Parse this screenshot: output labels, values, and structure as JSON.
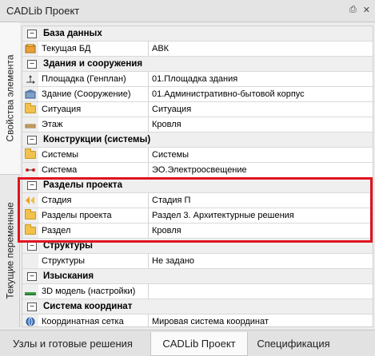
{
  "window": {
    "title": "CADLib Проект",
    "pin_icon": "pin-icon",
    "close_icon": "close-icon"
  },
  "side_tabs": [
    {
      "label": "Свойства элемента"
    },
    {
      "label": "Текущие переменные"
    }
  ],
  "grid": {
    "rows": [
      {
        "kind": "cat",
        "label": "База данных",
        "toggle": "⊟"
      },
      {
        "kind": "prop",
        "icon": "database-icon",
        "name": "Текущая БД",
        "value": "АВК"
      },
      {
        "kind": "cat",
        "label": "Здания и сооружения",
        "toggle": "⊟"
      },
      {
        "kind": "prop",
        "icon": "site-plan-icon",
        "name": "Площадка (Генплан)",
        "value": "01.Площадка здания"
      },
      {
        "kind": "prop",
        "icon": "building-icon",
        "name": "Здание (Сооружение)",
        "value": "01.Административно-бытовой корпус"
      },
      {
        "kind": "prop",
        "icon": "folder-icon",
        "name": "Ситуация",
        "value": "Ситуация"
      },
      {
        "kind": "prop",
        "icon": "floor-icon",
        "name": "Этаж",
        "value": "Кровля"
      },
      {
        "kind": "cat",
        "label": "Конструкции (системы)",
        "toggle": "⊟"
      },
      {
        "kind": "prop",
        "icon": "folder-icon",
        "name": "Системы",
        "value": "Системы"
      },
      {
        "kind": "prop",
        "icon": "system-icon",
        "name": "Система",
        "value": "ЭО.Электроосвещение"
      },
      {
        "kind": "cat",
        "label": "Разделы проекта",
        "toggle": "⊟"
      },
      {
        "kind": "prop",
        "icon": "stage-icon",
        "name": "Стадия",
        "value": "Стадия П"
      },
      {
        "kind": "prop",
        "icon": "folder-icon",
        "name": "Разделы проекта",
        "value": "Раздел 3. Архитектурные решения"
      },
      {
        "kind": "prop",
        "icon": "folder-icon",
        "name": "Раздел",
        "value": "Кровля"
      },
      {
        "kind": "cat",
        "label": "Структуры",
        "toggle": "⊟"
      },
      {
        "kind": "prop",
        "icon": "",
        "name": "Структуры",
        "value": "Не задано"
      },
      {
        "kind": "cat",
        "label": "Изыскания",
        "toggle": "⊟"
      },
      {
        "kind": "prop",
        "icon": "terrain-icon",
        "name": "3D модель (настройки)",
        "value": ""
      },
      {
        "kind": "cat",
        "label": "Система координат",
        "toggle": "⊟"
      },
      {
        "kind": "prop",
        "icon": "globe-icon",
        "name": "Координатная сетка",
        "value": "Мировая система координат"
      }
    ]
  },
  "bottom_tabs": [
    {
      "label": "Узлы и готовые решения"
    },
    {
      "label": "CADLib Проект"
    },
    {
      "label": "Спецификация"
    }
  ]
}
